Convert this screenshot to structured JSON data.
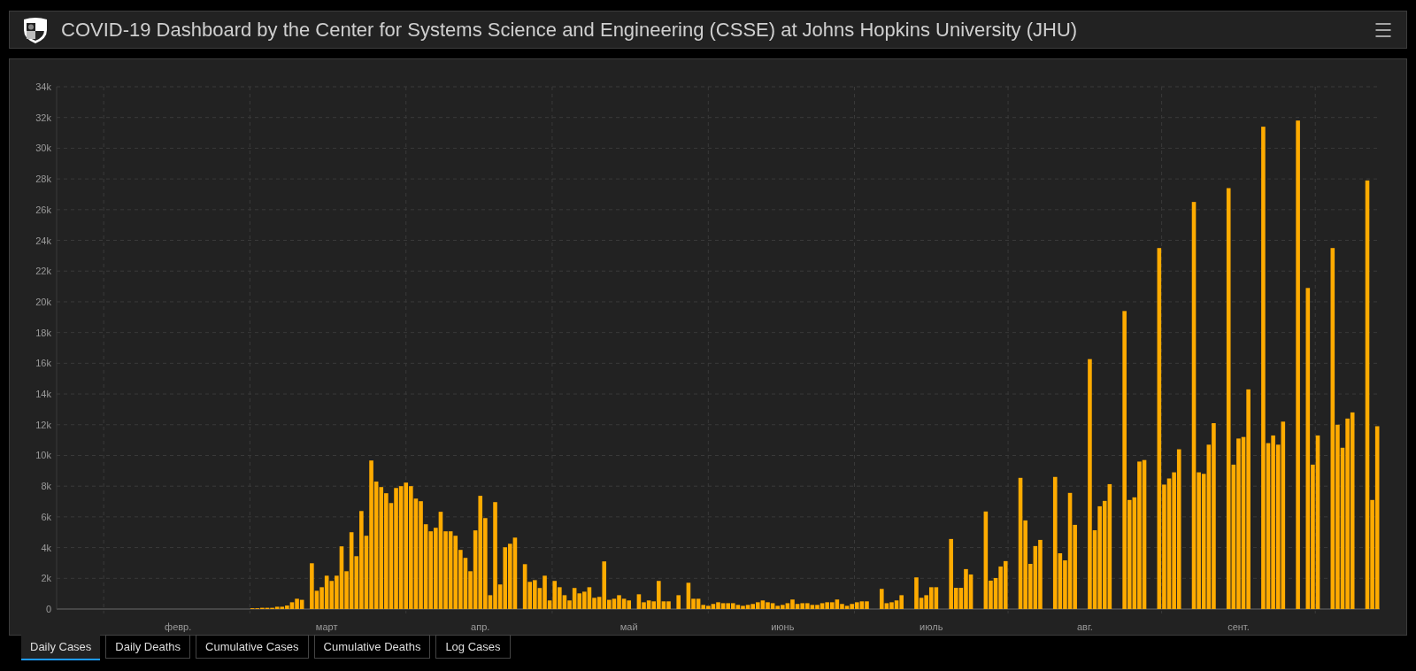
{
  "header": {
    "title": "COVID-19 Dashboard by the Center for Systems Science and Engineering (CSSE) at Johns Hopkins University (JHU)"
  },
  "chart_panel": {
    "chart_data": {
      "type": "bar",
      "grid": true,
      "ylim": [
        0,
        34000
      ],
      "categories": [
        null,
        null,
        null,
        null,
        null,
        null,
        null,
        null,
        null,
        null,
        null,
        null,
        null,
        null,
        null,
        null,
        null,
        null,
        null,
        null,
        null,
        null,
        null,
        null,
        "февр.",
        null,
        null,
        null,
        null,
        null,
        null,
        null,
        null,
        null,
        null,
        null,
        null,
        null,
        null,
        null,
        null,
        null,
        null,
        null,
        null,
        null,
        null,
        null,
        null,
        null,
        null,
        null,
        null,
        null,
        "март",
        null,
        null,
        null,
        null,
        null,
        null,
        null,
        null,
        null,
        null,
        null,
        null,
        null,
        null,
        null,
        null,
        null,
        null,
        null,
        null,
        null,
        null,
        null,
        null,
        null,
        null,
        null,
        null,
        null,
        null,
        "апр.",
        null,
        null,
        null,
        null,
        null,
        null,
        null,
        null,
        null,
        null,
        null,
        null,
        null,
        null,
        null,
        null,
        null,
        null,
        null,
        null,
        null,
        null,
        null,
        null,
        null,
        null,
        null,
        null,
        null,
        "май",
        null,
        null,
        null,
        null,
        null,
        null,
        null,
        null,
        null,
        null,
        null,
        null,
        null,
        null,
        null,
        null,
        null,
        null,
        null,
        null,
        null,
        null,
        null,
        null,
        null,
        null,
        null,
        null,
        null,
        null,
        "июнь",
        null,
        null,
        null,
        null,
        null,
        null,
        null,
        null,
        null,
        null,
        null,
        null,
        null,
        null,
        null,
        null,
        null,
        null,
        null,
        null,
        null,
        null,
        null,
        null,
        null,
        null,
        null,
        null,
        null,
        "июль",
        null,
        null,
        null,
        null,
        null,
        null,
        null,
        null,
        null,
        null,
        null,
        null,
        null,
        null,
        null,
        null,
        null,
        null,
        null,
        null,
        null,
        null,
        null,
        null,
        null,
        null,
        null,
        null,
        null,
        null,
        "авг.",
        null,
        null,
        null,
        null,
        null,
        null,
        null,
        null,
        null,
        null,
        null,
        null,
        null,
        null,
        null,
        null,
        null,
        null,
        null,
        null,
        null,
        null,
        null,
        null,
        null,
        null,
        null,
        null,
        null,
        null,
        "сент.",
        null,
        null,
        null,
        null,
        null,
        null,
        null,
        null,
        null,
        null,
        null,
        null,
        null,
        null,
        null,
        null,
        null,
        null,
        null,
        null,
        null,
        null,
        null,
        null,
        null,
        null,
        null,
        null
      ],
      "yticks": [
        {
          "value": 0,
          "label": "0"
        },
        {
          "value": 2000,
          "label": "2k"
        },
        {
          "value": 4000,
          "label": "4k"
        },
        {
          "value": 6000,
          "label": "6k"
        },
        {
          "value": 8000,
          "label": "8k"
        },
        {
          "value": 10000,
          "label": "10k"
        },
        {
          "value": 12000,
          "label": "12k"
        },
        {
          "value": 14000,
          "label": "14k"
        },
        {
          "value": 16000,
          "label": "16k"
        },
        {
          "value": 18000,
          "label": "18k"
        },
        {
          "value": 20000,
          "label": "20k"
        },
        {
          "value": 22000,
          "label": "22k"
        },
        {
          "value": 24000,
          "label": "24k"
        },
        {
          "value": 26000,
          "label": "26k"
        },
        {
          "value": 28000,
          "label": "28k"
        },
        {
          "value": 30000,
          "label": "30k"
        },
        {
          "value": 32000,
          "label": "32k"
        },
        {
          "value": 34000,
          "label": "34k"
        }
      ],
      "series": [
        {
          "color": "#ffab00",
          "values": [
            0,
            0,
            0,
            0,
            0,
            0,
            0,
            0,
            0,
            0,
            0,
            0,
            0,
            0,
            0,
            0,
            0,
            0,
            0,
            0,
            0,
            0,
            0,
            0,
            0,
            0,
            0,
            0,
            0,
            0,
            0,
            0,
            0,
            0,
            0,
            0,
            0,
            0,
            0,
            50,
            50,
            80,
            80,
            80,
            150,
            150,
            230,
            440,
            670,
            600,
            0,
            2980,
            1190,
            1420,
            2170,
            1830,
            2170,
            4080,
            2460,
            5000,
            3440,
            6380,
            4770,
            9670,
            8300,
            7940,
            7540,
            6900,
            7880,
            8000,
            8230,
            8000,
            7190,
            7020,
            5520,
            5060,
            5290,
            6330,
            5060,
            5060,
            4770,
            3850,
            3330,
            2460,
            5120,
            7370,
            5920,
            900,
            6960,
            1600,
            4020,
            4250,
            4650,
            0,
            2920,
            1770,
            1880,
            1370,
            2170,
            560,
            1830,
            1420,
            900,
            560,
            1370,
            1020,
            1130,
            1420,
            730,
            790,
            3100,
            600,
            670,
            900,
            670,
            560,
            0,
            960,
            440,
            560,
            500,
            1830,
            500,
            500,
            0,
            900,
            0,
            1710,
            670,
            670,
            270,
            210,
            330,
            440,
            380,
            380,
            380,
            270,
            210,
            270,
            330,
            440,
            560,
            440,
            380,
            210,
            270,
            380,
            620,
            330,
            380,
            380,
            270,
            270,
            380,
            440,
            440,
            620,
            330,
            210,
            330,
            440,
            500,
            500,
            0,
            0,
            1310,
            380,
            440,
            560,
            900,
            0,
            0,
            2060,
            730,
            900,
            1420,
            1420,
            0,
            0,
            4560,
            1380,
            1380,
            2600,
            2250,
            0,
            0,
            6350,
            1850,
            2020,
            2770,
            3120,
            0,
            0,
            8540,
            5770,
            2940,
            4100,
            4500,
            0,
            0,
            8600,
            3630,
            3170,
            7560,
            5480,
            0,
            0,
            16270,
            5130,
            6690,
            7040,
            8130,
            0,
            0,
            19400,
            7100,
            7270,
            9600,
            9700,
            0,
            0,
            23500,
            8100,
            8500,
            8900,
            10400,
            0,
            0,
            26500,
            8900,
            8800,
            10700,
            12100,
            0,
            0,
            27400,
            9400,
            11100,
            11200,
            14300,
            0,
            0,
            31400,
            10800,
            11300,
            10700,
            12200,
            0,
            0,
            31800,
            0,
            20900,
            9400,
            11300,
            0,
            0,
            23500,
            12000,
            10500,
            12400,
            12800,
            0,
            0,
            27900,
            7100,
            11900
          ]
        }
      ]
    }
  },
  "tabs": [
    {
      "label": "Daily Cases",
      "selected": true
    },
    {
      "label": "Daily Deaths",
      "selected": false
    },
    {
      "label": "Cumulative Cases",
      "selected": false
    },
    {
      "label": "Cumulative Deaths",
      "selected": false
    },
    {
      "label": "Log Cases",
      "selected": false
    }
  ]
}
